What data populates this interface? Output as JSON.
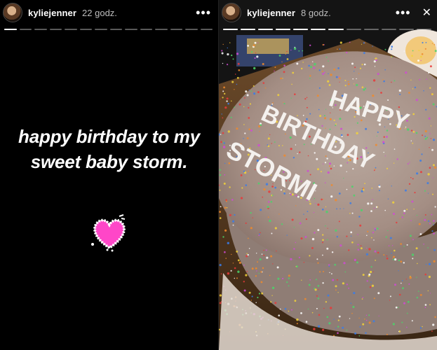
{
  "stories": [
    {
      "username": "kyliejenner",
      "time": "22 godz.",
      "segments_total": 14,
      "segments_filled": 1,
      "caption_line1": "happy birthday to my",
      "caption_line2": "sweet baby storm.",
      "sticker": "heart-sticker",
      "heart_color": "#ff3fc8"
    },
    {
      "username": "kyliejenner",
      "time": "8 godz.",
      "segments_total": 12,
      "segments_filled": 7,
      "photo": "birthday-cake-photo",
      "cake_text": "HAPPY BIRTHDAY STORMI"
    }
  ],
  "icons": {
    "more": "•••",
    "close": "✕"
  }
}
